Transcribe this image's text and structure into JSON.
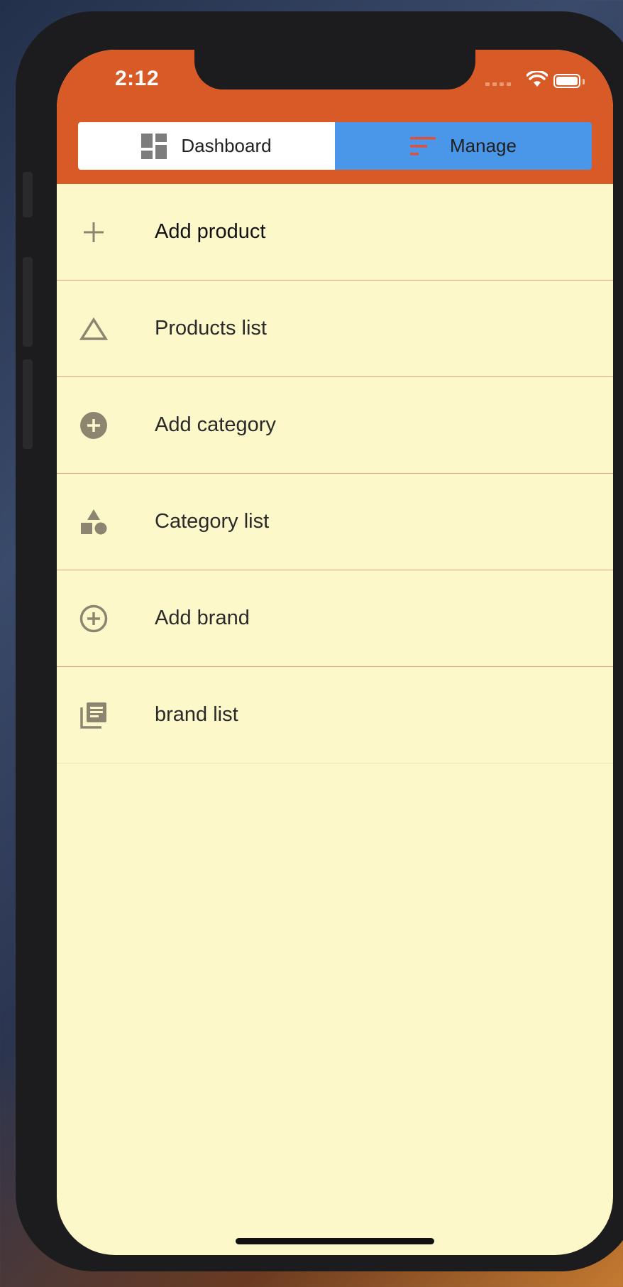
{
  "status_bar": {
    "time": "2:12"
  },
  "tabs": [
    {
      "label": "Dashboard",
      "icon": "dashboard-icon",
      "selected": false
    },
    {
      "label": "Manage",
      "icon": "sort-icon",
      "selected": true
    }
  ],
  "menu": {
    "items": [
      {
        "label": "Add product",
        "icon": "plus-icon"
      },
      {
        "label": "Products list",
        "icon": "triangle-outline-icon"
      },
      {
        "label": "Add category",
        "icon": "add-circle-filled-icon"
      },
      {
        "label": "Category list",
        "icon": "shapes-icon"
      },
      {
        "label": "Add brand",
        "icon": "add-circle-outline-icon"
      },
      {
        "label": "brand list",
        "icon": "library-books-icon"
      }
    ]
  },
  "colors": {
    "appbar": "#d85a27",
    "tab_selected": "#4a96e8",
    "tab_unselected": "#ffffff",
    "list_background": "#fdf8ca",
    "divider": "#e8a08a",
    "icon": "#8c8670"
  }
}
